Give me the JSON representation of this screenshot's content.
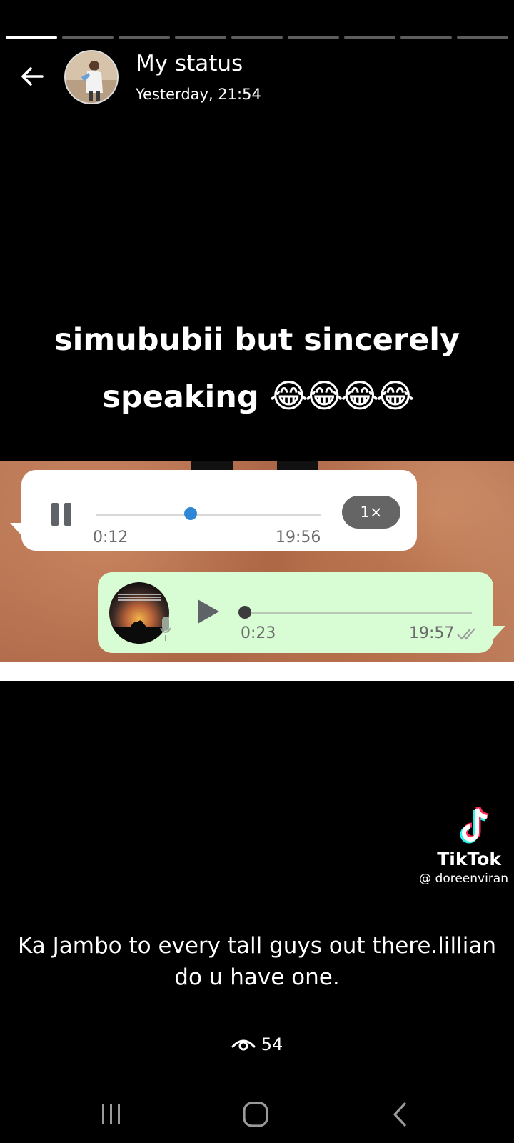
{
  "status": {
    "segments_total": 9,
    "active_segment": 1,
    "title": "My status",
    "timestamp": "Yesterday, 21:54"
  },
  "overlay": {
    "line1": "simububii but sincerely",
    "line2": "speaking",
    "emojis": "😂😂😂😂"
  },
  "media": {
    "incoming_voice": {
      "elapsed": "0:12",
      "time": "19:56",
      "speed": "1×",
      "progress": 0.42
    },
    "outgoing_voice": {
      "duration": "0:23",
      "time": "19:57",
      "progress": 0.0
    }
  },
  "watermark": {
    "brand": "TikTok",
    "handle": "@ doreenviran"
  },
  "caption": "Ka Jambo to every tall guys out there.lillian do u have one.",
  "views": {
    "count": "54",
    "icon": "eye-icon"
  },
  "navigation": {
    "recents_icon": "recents-icon",
    "home_icon": "home-icon",
    "back_icon": "back-icon"
  },
  "colors": {
    "background": "#000000",
    "outgoing_bubble": "#d8fcd3",
    "incoming_dot": "#2e86d6"
  }
}
